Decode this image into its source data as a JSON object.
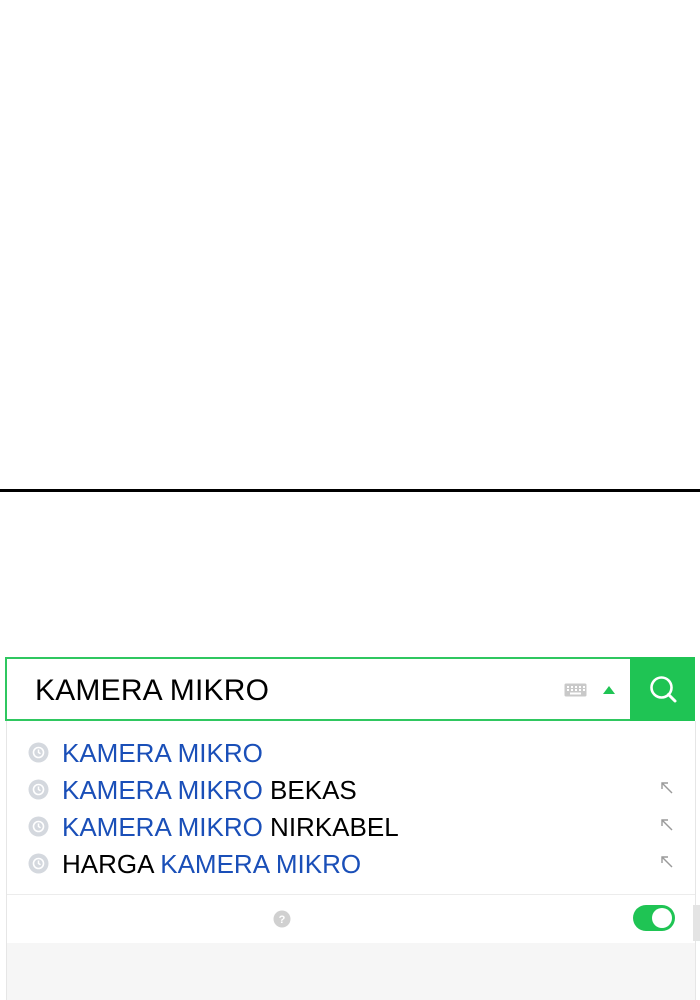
{
  "search": {
    "value": "KAMERA MIKRO",
    "accent_color": "#1fc454",
    "submit_icon": "search-icon",
    "keyboard_icon": "keyboard-icon",
    "dropdown_icon": "caret-up-icon"
  },
  "suggestions": [
    {
      "parts": [
        {
          "text": "KAMERA MIKRO",
          "highlight": true
        }
      ],
      "arrow": false
    },
    {
      "parts": [
        {
          "text": "KAMERA MIKRO",
          "highlight": true
        },
        {
          "text": " BEKAS",
          "highlight": false
        }
      ],
      "arrow": true
    },
    {
      "parts": [
        {
          "text": "KAMERA MIKRO",
          "highlight": true
        },
        {
          "text": " NIRKABEL",
          "highlight": false
        }
      ],
      "arrow": true
    },
    {
      "parts": [
        {
          "text": "HARGA ",
          "highlight": false
        },
        {
          "text": "KAMERA MIKRO",
          "highlight": true
        }
      ],
      "arrow": true
    }
  ],
  "footer": {
    "help_icon": "help-icon",
    "toggle_on": true
  },
  "colors": {
    "highlight_text": "#1a4fb8",
    "plain_text": "#000000",
    "toggle": "#1fc454"
  }
}
